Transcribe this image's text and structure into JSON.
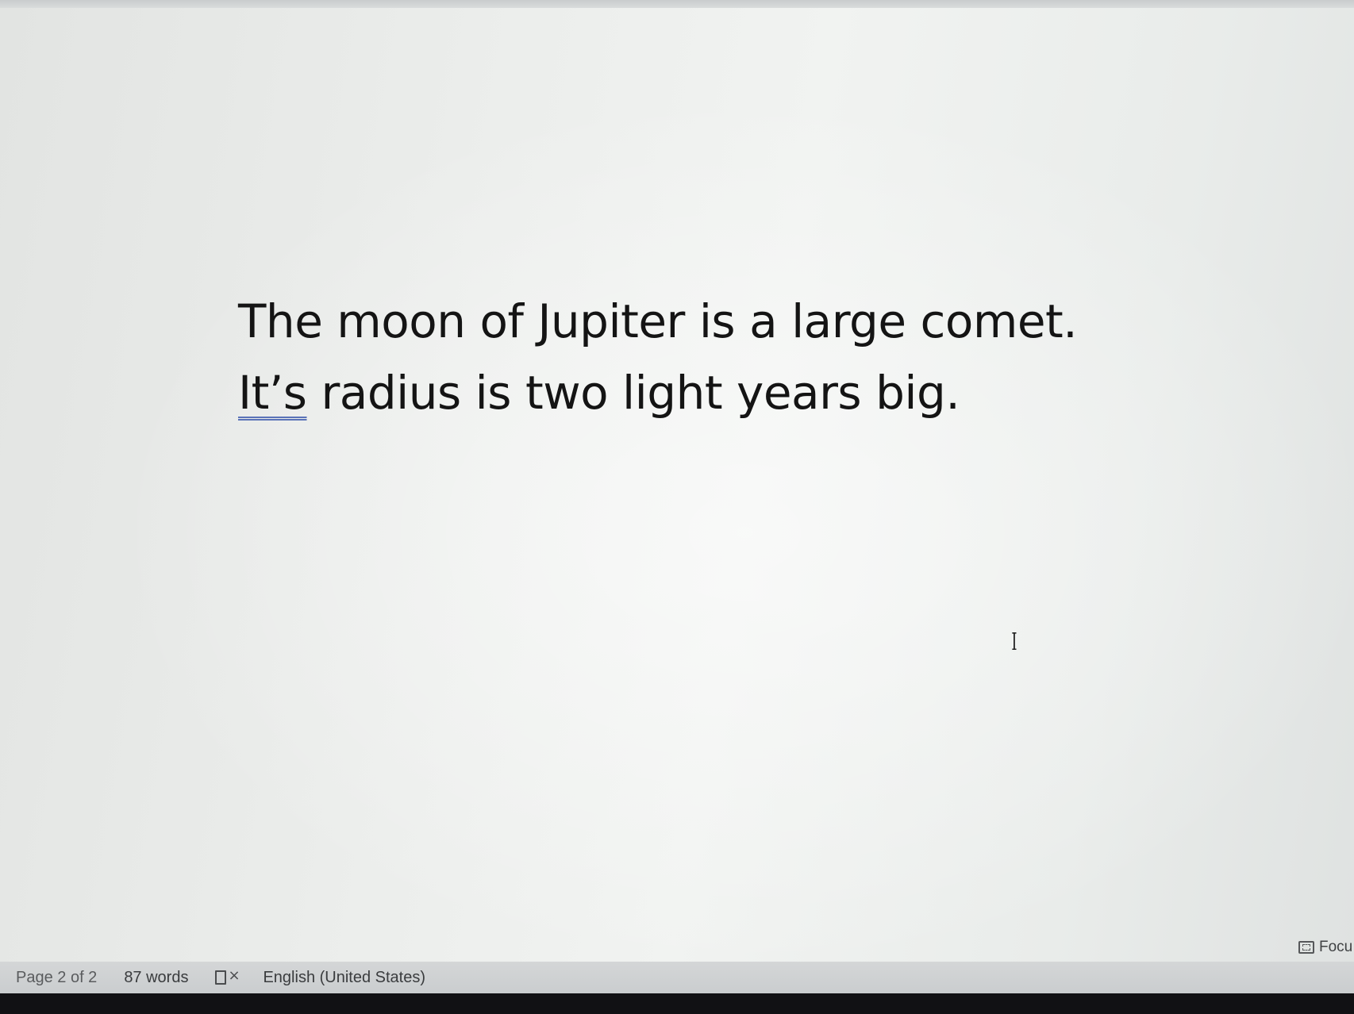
{
  "document": {
    "lines": [
      {
        "text": "The moon of Jupiter is a large comet."
      },
      {
        "flagged_word": "It’s",
        "rest": " radius is two light years big."
      }
    ]
  },
  "status_bar": {
    "page_info": "Page 2 of 2",
    "word_count": "87 words",
    "proofing_icon": "proofing-error-icon",
    "language": "English (United States)"
  },
  "view_controls": {
    "focus_label": "Focu",
    "focus_icon": "focus-mode-icon"
  },
  "colors": {
    "page_background": "#eceeec",
    "text": "#141414",
    "spelling_underline": "#5a73b8",
    "status_bar": "#cfd1d3"
  }
}
